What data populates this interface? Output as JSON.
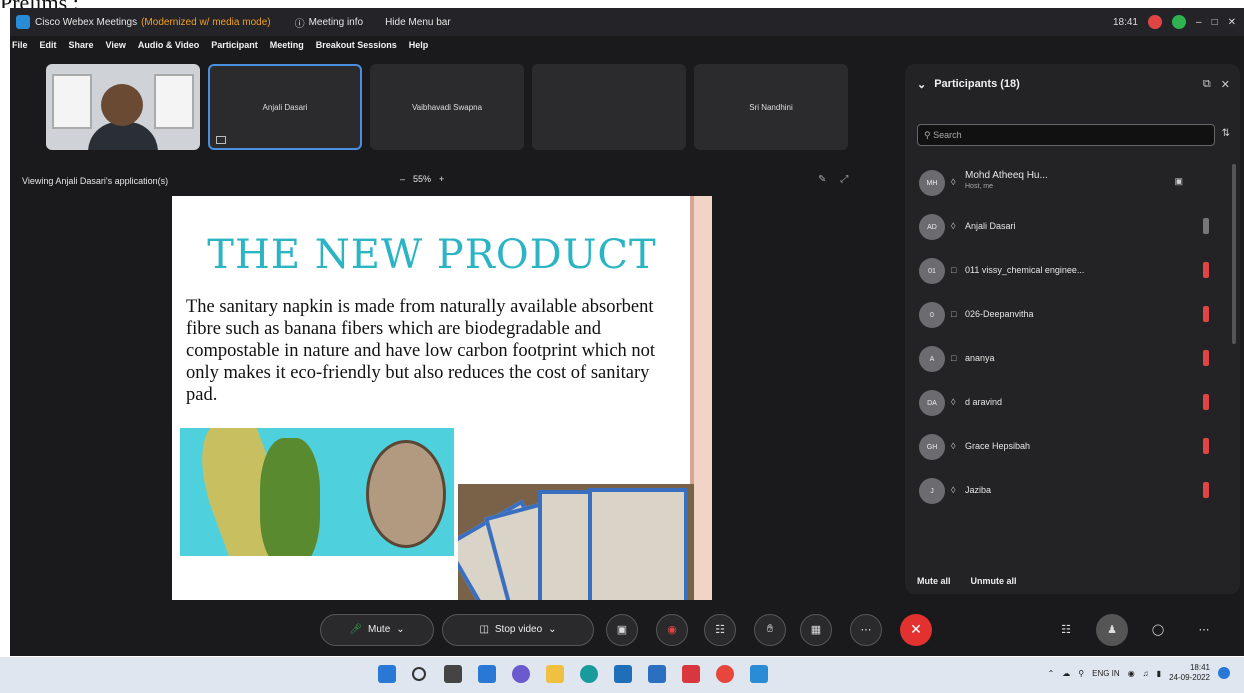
{
  "caption": "Prelims :",
  "titlebar": {
    "app": "Cisco Webex Meetings",
    "app_extra": "(Modernized w/ media mode)",
    "meeting_info": "Meeting info",
    "hide_menu": "Hide Menu bar",
    "clock": "18:41"
  },
  "menu": [
    "File",
    "Edit",
    "Share",
    "View",
    "Audio & Video",
    "Participant",
    "Meeting",
    "Breakout Sessions",
    "Help"
  ],
  "videos": [
    {
      "name": ""
    },
    {
      "name": "Anjali Dasari"
    },
    {
      "name": "Vaibhavadi Swapna"
    },
    {
      "name": ""
    },
    {
      "name": "Sri Nandhini"
    }
  ],
  "share": {
    "viewing": "Viewing Anjali Dasari's application(s)",
    "zoom": "55%"
  },
  "slide": {
    "title": "THE NEW PRODUCT",
    "body": "The sanitary napkin is made from naturally available absorbent fibre such as banana fibers which are biodegradable and compostable in nature and have low carbon footprint which not only makes it eco-friendly but also reduces the cost of sanitary pad."
  },
  "participants": {
    "title": "Participants (18)",
    "search_placeholder": "Search",
    "mute_all": "Mute all",
    "unmute_all": "Unmute all",
    "list": [
      {
        "initials": "MH",
        "name": "Mohd Atheeq Hu...",
        "sub": "Host, me",
        "muted": false
      },
      {
        "initials": "AD",
        "name": "Anjali Dasari",
        "sub": "",
        "muted": false
      },
      {
        "initials": "01",
        "name": "011 vissy_chemical enginee...",
        "sub": "",
        "muted": true
      },
      {
        "initials": "0",
        "name": "026-Deepanvitha",
        "sub": "",
        "muted": true
      },
      {
        "initials": "A",
        "name": "ananya",
        "sub": "",
        "muted": true
      },
      {
        "initials": "DA",
        "name": "d aravind",
        "sub": "",
        "muted": true
      },
      {
        "initials": "GH",
        "name": "Grace Hepsibah",
        "sub": "",
        "muted": true
      },
      {
        "initials": "J",
        "name": "Jaziba",
        "sub": "",
        "muted": true
      }
    ]
  },
  "controls": {
    "mute": "Mute",
    "stop_video": "Stop video"
  },
  "tray": {
    "lang": "ENG IN",
    "time": "18:41",
    "date": "24-09-2022"
  }
}
